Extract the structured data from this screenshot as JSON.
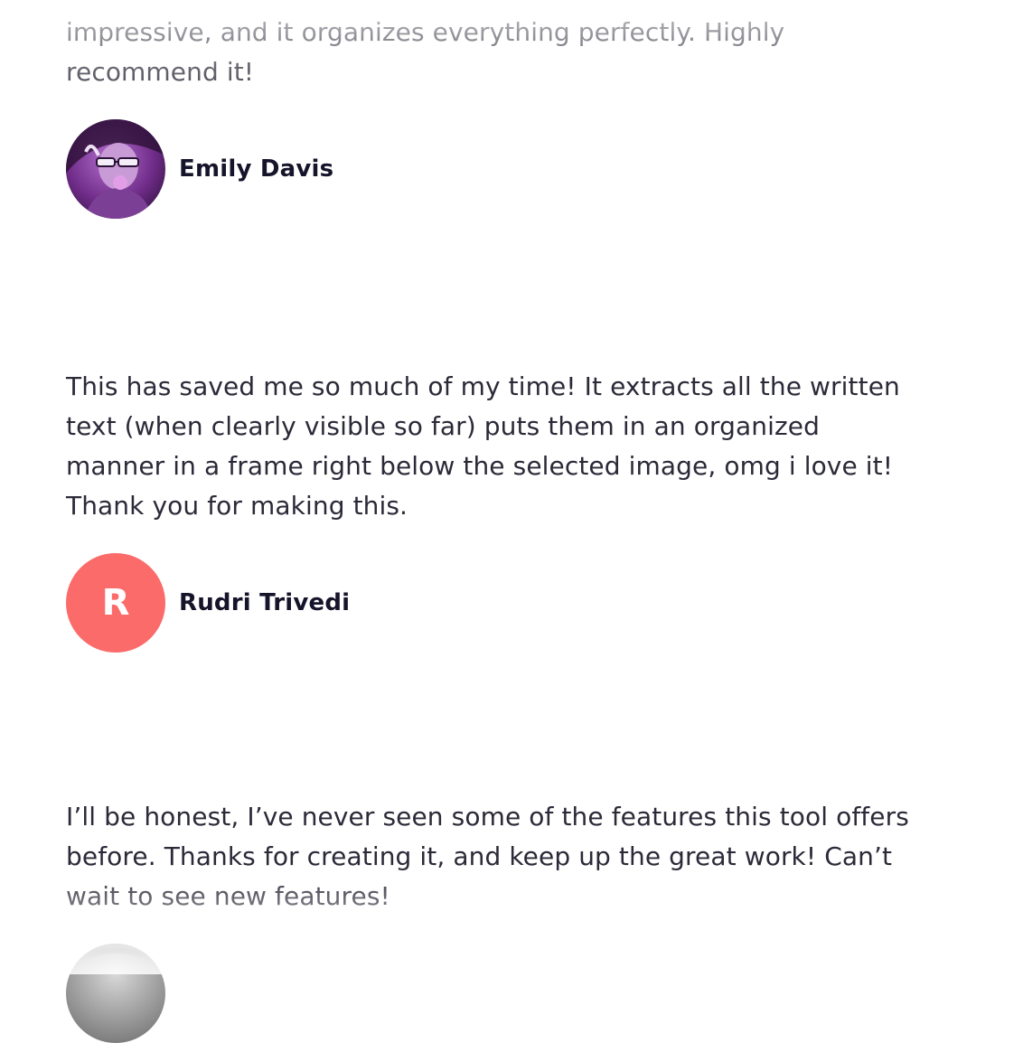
{
  "reviews": [
    {
      "text_lines": [
        "impressive, and it organizes everything perfectly. Highly",
        "recommend it!"
      ],
      "author": "Emily Davis",
      "avatar": {
        "type": "photo",
        "icon": "user-photo-avatar",
        "tint": "#8e3fae"
      }
    },
    {
      "text_lines": [
        "This has saved me so much of my time! It extracts all the written",
        "text (when clearly visible so far) puts them in an organized",
        "manner in a frame right below the selected image,  omg i love it!",
        "Thank you for making this."
      ],
      "author": "Rudri Trivedi",
      "avatar": {
        "type": "initial",
        "initial": "R",
        "color": "#fb6b6a"
      }
    },
    {
      "text_lines": [
        "I’ll be honest, I’ve never seen some of the features this tool offers",
        "before. Thanks for creating it, and keep up the great work! Can’t",
        "wait to see new features!"
      ],
      "avatar": {
        "type": "photo",
        "icon": "user-photo-avatar",
        "tint": "#9a9a9a"
      }
    }
  ],
  "colors": {
    "text": "#2b2a38",
    "author": "#16142a",
    "background": "#ffffff"
  }
}
